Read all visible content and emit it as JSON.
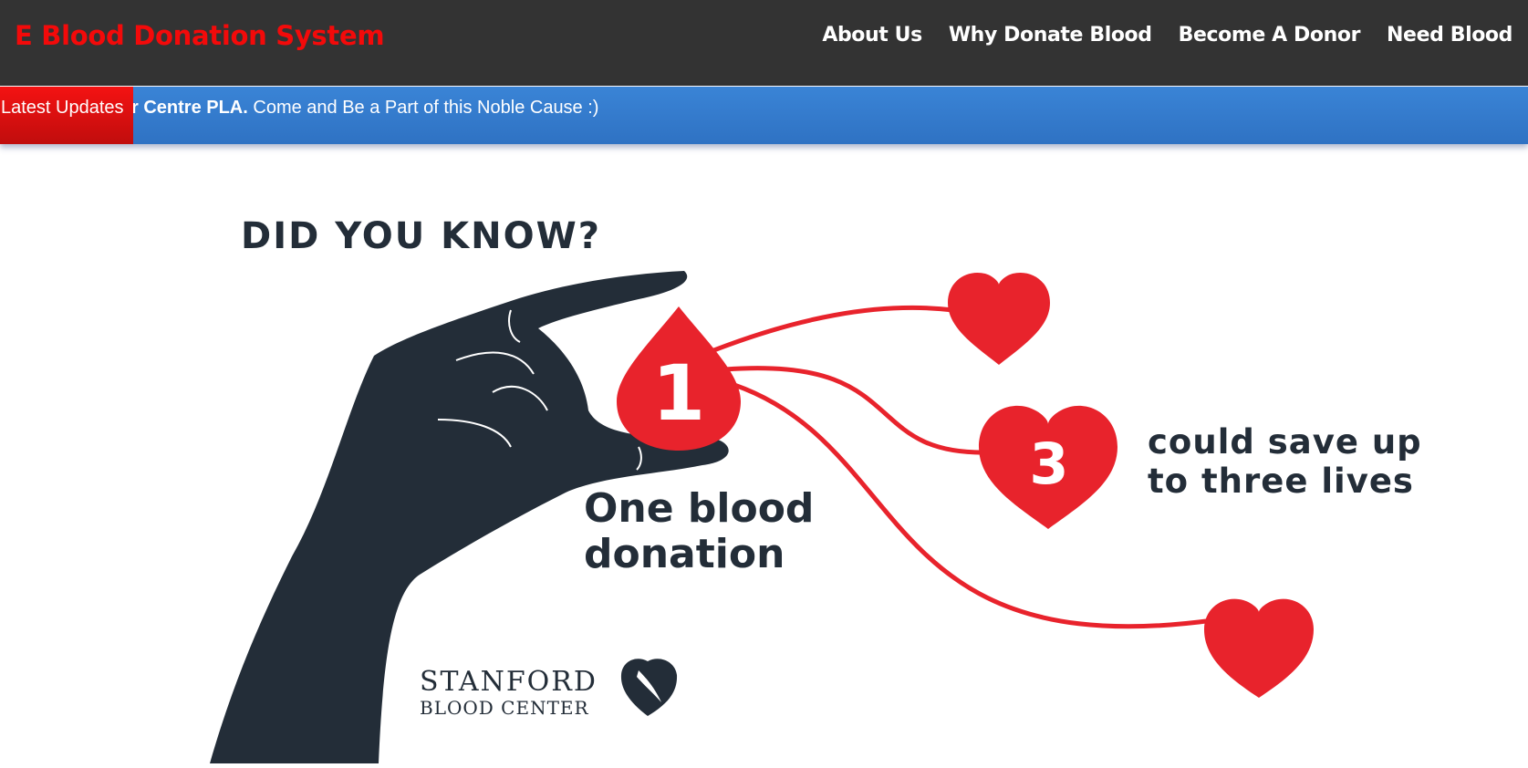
{
  "header": {
    "brand": "E Blood Donation System",
    "nav": [
      "About Us",
      "Why Donate Blood",
      "Become A Donor",
      "Need Blood"
    ]
  },
  "ticker": {
    "label": "Latest Updates",
    "bold_text": "r Centre PLA.",
    "text": "Come and Be a Part of this Noble Cause :)"
  },
  "infographic": {
    "heading": "DID YOU KNOW?",
    "drop_number": "1",
    "heart_number": "3",
    "line1a": "One blood",
    "line1b": "donation",
    "line2a": "could save up",
    "line2b": "to three lives",
    "logo_line1": "STANFORD",
    "logo_line2": "BLOOD CENTER"
  },
  "colors": {
    "brand": "#f30a0a",
    "navbar": "#333333",
    "ticker": "#3a84d6",
    "ticker_label": "#f41212",
    "blood_red": "#e8232c",
    "ink": "#232d38"
  },
  "icons": [
    "blood-drop-icon",
    "heart-icon",
    "hand-illustration",
    "stanford-heart-logo"
  ]
}
